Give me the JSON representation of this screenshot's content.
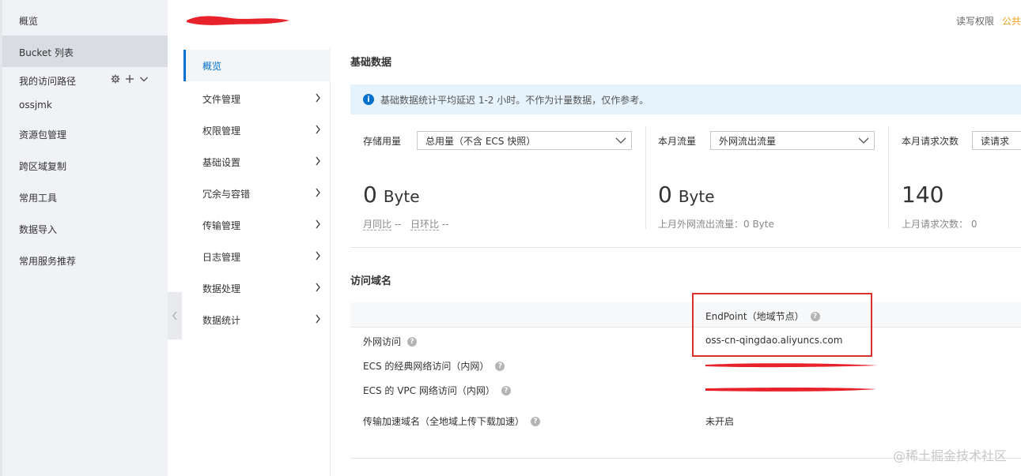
{
  "sidebar": {
    "items": [
      {
        "label": "概览"
      },
      {
        "label": "Bucket 列表"
      },
      {
        "label": "我的访问路径"
      },
      {
        "label": "ossjmk"
      },
      {
        "label": "资源包管理"
      },
      {
        "label": "跨区域复制"
      },
      {
        "label": "常用工具"
      },
      {
        "label": "数据导入"
      },
      {
        "label": "常用服务推荐"
      }
    ],
    "active_index": 1,
    "tools": [
      "gear-icon",
      "plus-icon",
      "chevron-down-icon"
    ]
  },
  "header": {
    "permission_label": "读写权限",
    "permission_value": "公共"
  },
  "subnav": {
    "items": [
      {
        "label": "概览"
      },
      {
        "label": "文件管理"
      },
      {
        "label": "权限管理"
      },
      {
        "label": "基础设置"
      },
      {
        "label": "冗余与容错"
      },
      {
        "label": "传输管理"
      },
      {
        "label": "日志管理"
      },
      {
        "label": "数据处理"
      },
      {
        "label": "数据统计"
      }
    ],
    "active_index": 0
  },
  "basic_data": {
    "title": "基础数据",
    "notice": "基础数据统计平均延迟 1-2 小时。不作为计量数据，仅作参考。",
    "stats": [
      {
        "label": "存储用量",
        "select_value": "总用量（不含 ECS 快照）",
        "value": "0",
        "unit": "Byte",
        "sub_a_label": "月同比",
        "sub_a_value": "--",
        "sub_b_label": "日环比",
        "sub_b_value": "--"
      },
      {
        "label": "本月流量",
        "select_value": "外网流出流量",
        "value": "0",
        "unit": "Byte",
        "sub": "上月外网流出流量：0 Byte"
      },
      {
        "label": "本月请求次数",
        "select_value": "读请求",
        "value": "140",
        "sub": "上月请求次数： 0"
      }
    ]
  },
  "domains": {
    "title": "访问域名",
    "endpoint_header": "EndPoint（地域节点）",
    "rows": [
      {
        "label": "外网访问",
        "value": "oss-cn-qingdao.aliyuncs.com"
      },
      {
        "label": "ECS 的经典网络访问（内网）",
        "value": ""
      },
      {
        "label": "ECS 的 VPC 网络访问（内网）",
        "value": ""
      },
      {
        "label": "传输加速域名（全地域上传下载加速）",
        "value": "未开启"
      }
    ]
  },
  "watermark": "@稀土掘金技术社区",
  "colors": {
    "accent": "#0070cc",
    "highlight_box": "#d9302c",
    "redaction": "#e8222a",
    "permission": "#f0a020"
  }
}
